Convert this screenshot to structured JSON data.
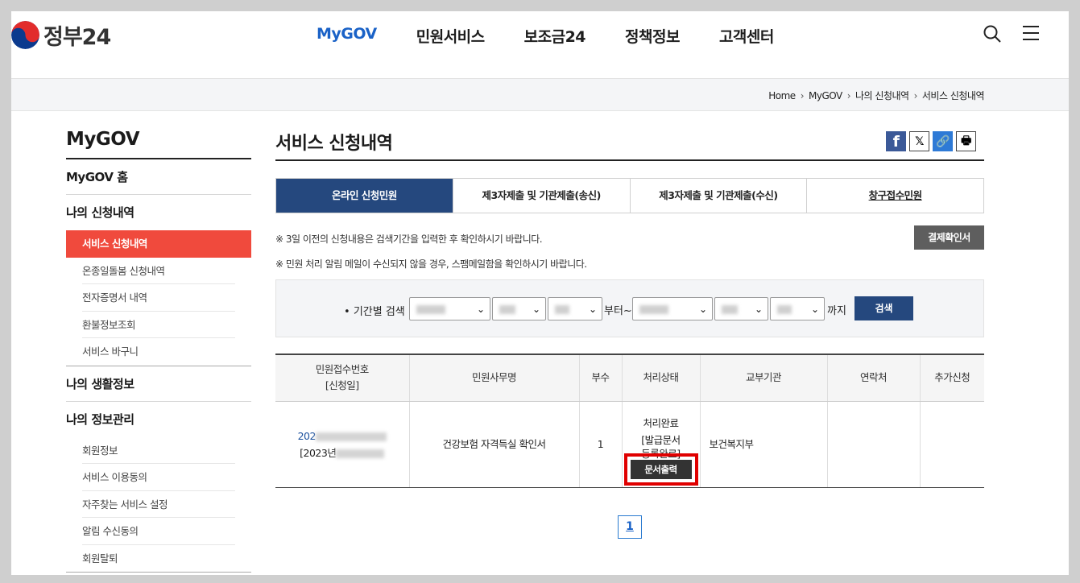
{
  "logo": {
    "text": "정부24"
  },
  "gnb": [
    "MyGOV",
    "민원서비스",
    "보조금24",
    "정책정보",
    "고객센터"
  ],
  "breadcrumb": [
    "Home",
    "MyGOV",
    "나의 신청내역",
    "서비스 신청내역"
  ],
  "lnb": {
    "title": "MyGOV",
    "home": "MyGOV 홈",
    "groups": [
      {
        "label": "나의 신청내역",
        "items": [
          "서비스 신청내역",
          "온종일돌봄 신청내역",
          "전자증명서 내역",
          "환불정보조회",
          "서비스 바구니"
        ]
      },
      {
        "label": "나의 생활정보",
        "items": []
      },
      {
        "label": "나의 정보관리",
        "items": [
          "회원정보",
          "서비스 이용동의",
          "자주찾는 서비스 설정",
          "알림 수신동의",
          "회원탈퇴"
        ]
      }
    ]
  },
  "page": {
    "title": "서비스 신청내역"
  },
  "share": {
    "facebook": "f",
    "x": "𝕏",
    "link": "🔗",
    "print": "🖶"
  },
  "tabs": [
    "온라인 신청민원",
    "제3자제출 및 기관제출(송신)",
    "제3자제출 및 기관제출(수신)",
    "창구접수민원"
  ],
  "notices": [
    "※ 3일 이전의 신청내용은 검색기간을 입력한 후 확인하시기 바랍니다.",
    "※ 민원 처리 알림 메일이 수신되지 않을 경우, 스팸메일함을 확인하시기 바랍니다."
  ],
  "payment_button": "결제확인서",
  "search": {
    "label": "기간별 검색",
    "from": "부터~",
    "until": "까지",
    "button": "검색"
  },
  "table": {
    "headers": [
      "민원접수번호\n[신청일]",
      "민원사무명",
      "부수",
      "처리상태",
      "교부기관",
      "연락처",
      "추가신청"
    ],
    "row": {
      "receipt_prefix": "202",
      "date_prefix": "[2023년",
      "name": "건강보험 자격득실 확인서",
      "copies": "1",
      "status_lines": [
        "처리완료",
        "[발급문서",
        "등록완료]"
      ],
      "print_button": "문서출력",
      "agency": "보건복지부",
      "contact": "",
      "extra": ""
    }
  },
  "pagination": {
    "current": "1"
  }
}
